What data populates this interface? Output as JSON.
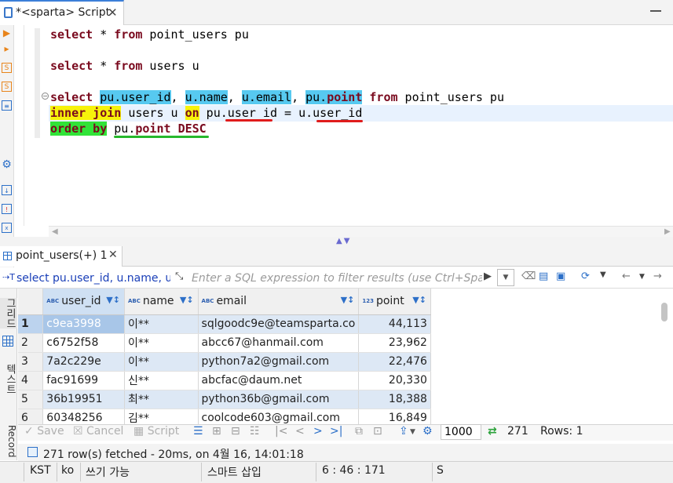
{
  "editor_tab": {
    "title": "*<sparta> Script",
    "close": "✕"
  },
  "sql": {
    "line1": {
      "kw1": "select",
      "rest1": " * ",
      "kw2": "from",
      "rest2": " point_users pu"
    },
    "line2": {
      "kw1": "select",
      "rest1": " * ",
      "kw2": "from",
      "rest2": " users u"
    },
    "line3": {
      "kw1": "select",
      "sp": " ",
      "c1": "pu.user_id",
      "s1": ", ",
      "c2": "u.name",
      "s2": ", ",
      "c3": "u.email",
      "s3": ", ",
      "c4a": "pu.",
      "c4b": "point",
      "sp2": " ",
      "kw2": "from",
      "rest": " point_users pu"
    },
    "line4": {
      "kw": "inner join",
      "t1": " users u ",
      "kw2": "on",
      "t2": " pu.",
      "t3": "user_id",
      "t4": " = u.",
      "t5": "user_id"
    },
    "line5": {
      "kw": "order by",
      "t1": " pu.",
      "t2": "point",
      "t3": " ",
      "t4": "DESC"
    }
  },
  "results_tab": {
    "title": "point_users(+) 1",
    "close": "✕"
  },
  "filter": {
    "lead_icon": "⇢T",
    "query_label": "select pu.user_id, u.name, u.email",
    "placeholder": "Enter a SQL expression to filter results (use Ctrl+Space)"
  },
  "side_tabs": {
    "grid": "그리드",
    "text": "텍스트",
    "record": "Record"
  },
  "grid": {
    "columns": [
      {
        "type": "ABC",
        "name": "user_id"
      },
      {
        "type": "ABC",
        "name": "name"
      },
      {
        "type": "ABC",
        "name": "email"
      },
      {
        "type": "123",
        "name": "point"
      }
    ],
    "rows": [
      {
        "n": "1",
        "user_id": "c9ea3998",
        "name": "이**",
        "email": "sqlgoodc9e@teamsparta.co",
        "point": "44,113"
      },
      {
        "n": "2",
        "user_id": "c6752f58",
        "name": "이**",
        "email": "abcc67@hanmail.com",
        "point": "23,962"
      },
      {
        "n": "3",
        "user_id": "7a2c229e",
        "name": "이**",
        "email": "python7a2@gmail.com",
        "point": "22,476"
      },
      {
        "n": "4",
        "user_id": "fac91699",
        "name": "신**",
        "email": "abcfac@daum.net",
        "point": "20,330"
      },
      {
        "n": "5",
        "user_id": "36b19951",
        "name": "최**",
        "email": "python36b@gmail.com",
        "point": "18,388"
      },
      {
        "n": "6",
        "user_id": "60348256",
        "name": "김**",
        "email": "coolcode603@gmail.com",
        "point": "16,849"
      }
    ]
  },
  "toolbar": {
    "save": "Save",
    "cancel": "Cancel",
    "script": "Script",
    "fetch_size": "1000",
    "row_count": "271",
    "rows_label": "Rows: 1"
  },
  "fetch_info": "271 row(s) fetched - 20ms, on 4월 16, 14:01:18",
  "status": {
    "timezone": "KST",
    "locale": "ko",
    "writable": "쓰기 가능",
    "insert_mode": "스마트 삽입",
    "position": "6 : 46 : 171",
    "extra": "S"
  }
}
